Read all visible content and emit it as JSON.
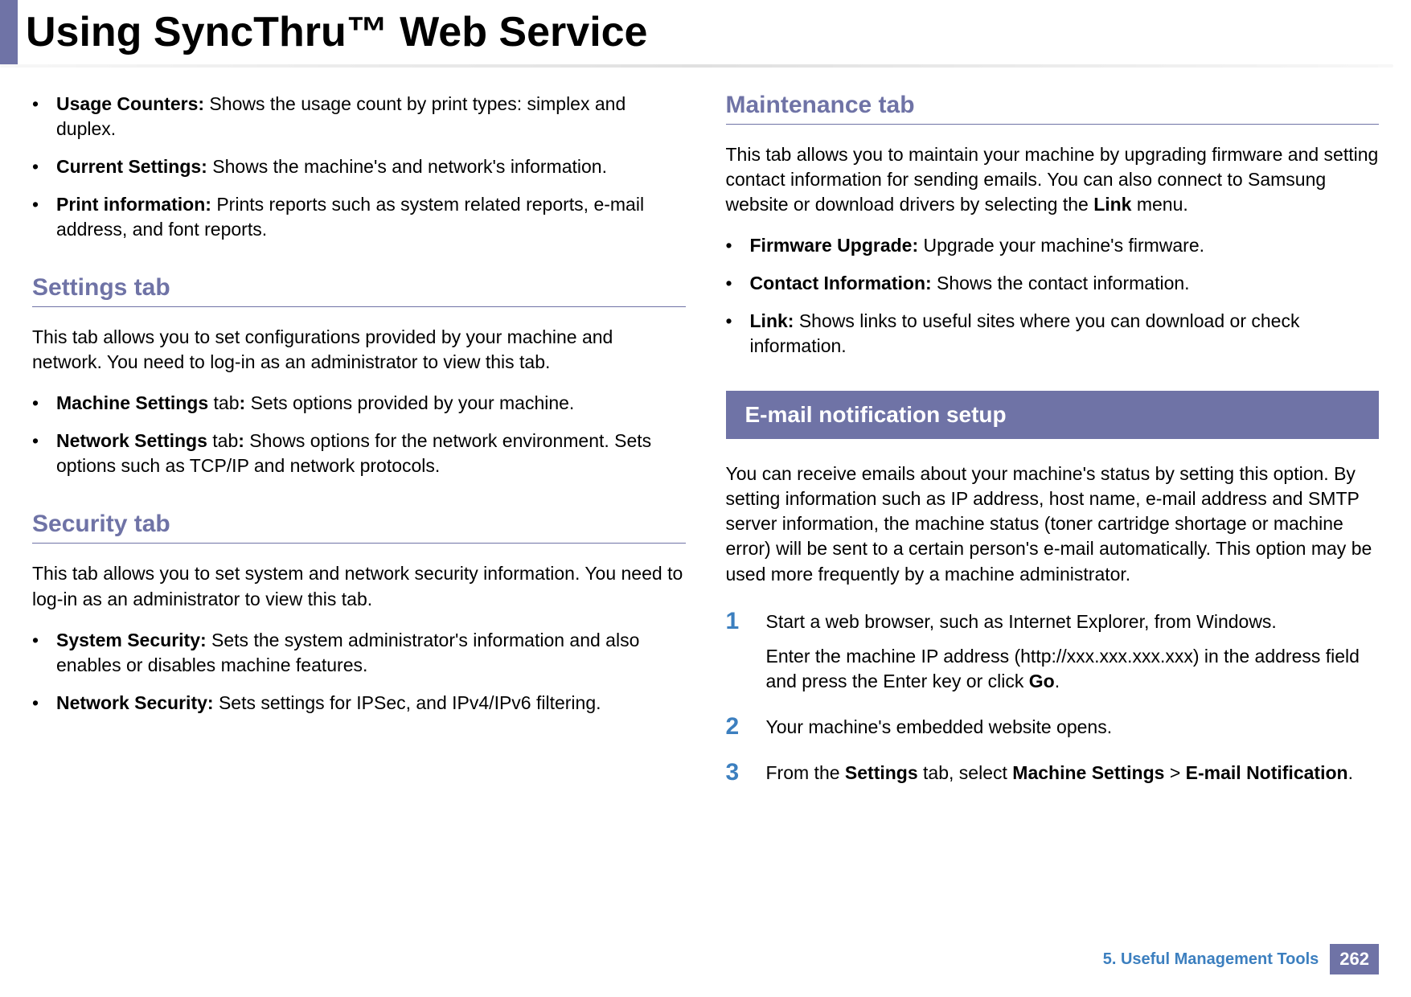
{
  "header": {
    "title": "Using SyncThru™ Web Service"
  },
  "left": {
    "bullets_top": [
      {
        "label": "Usage Counters:",
        "desc": " Shows the usage count by print types: simplex and duplex."
      },
      {
        "label": "Current Settings:",
        "desc": " Shows the machine's and network's information."
      },
      {
        "label": "Print information:",
        "desc": " Prints reports such as system related reports, e-mail address, and font reports."
      }
    ],
    "settings": {
      "title": "Settings tab",
      "intro": "This tab allows you to set configurations provided by your machine and network. You need to log-in as an administrator to view this tab.",
      "bullets": [
        {
          "label": "Machine Settings",
          "mid": " tab",
          "colon": ":",
          "desc": " Sets options provided by your machine."
        },
        {
          "label": "Network Settings",
          "mid": " tab",
          "colon": ":",
          "desc": " Shows options for the network environment. Sets options such as TCP/IP and network protocols."
        }
      ]
    },
    "security": {
      "title": "Security tab",
      "intro": "This tab allows you to set system and network security information. You need to log-in as an administrator to view this tab.",
      "bullets": [
        {
          "label": "System Security:",
          "desc": " Sets the system administrator's information and also enables or disables machine features."
        },
        {
          "label": "Network Security:",
          "desc": " Sets settings for IPSec, and IPv4/IPv6 filtering."
        }
      ]
    }
  },
  "right": {
    "maintenance": {
      "title": "Maintenance tab",
      "intro_pre": "This tab allows you to maintain your machine by upgrading firmware and setting contact information for sending emails. You can also connect to Samsung website or download drivers by selecting the ",
      "intro_bold": "Link",
      "intro_post": " menu.",
      "bullets": [
        {
          "label": "Firmware Upgrade:",
          "desc": " Upgrade your machine's firmware."
        },
        {
          "label": "Contact Information:",
          "desc": " Shows the contact information."
        },
        {
          "label": "Link:",
          "desc": " Shows links to useful sites where you can download or check information."
        }
      ]
    },
    "email_setup": {
      "block": "E-mail notification setup",
      "intro": "You can receive emails about your machine's status by setting this option. By setting information such as IP address, host name, e-mail address and SMTP server information, the machine status (toner cartridge shortage or machine error) will be sent to a certain person's e-mail automatically. This option may be used more frequently by a machine administrator.",
      "steps": {
        "s1": {
          "num": "1",
          "p1": "Start a web browser, such as Internet Explorer, from Windows.",
          "p2_pre": "Enter the machine IP address (http://xxx.xxx.xxx.xxx) in the address field and press the Enter key or click ",
          "p2_bold": "Go",
          "p2_post": "."
        },
        "s2": {
          "num": "2",
          "text": "Your machine's embedded website opens."
        },
        "s3": {
          "num": "3",
          "pre": "From the ",
          "b1": "Settings",
          "mid1": " tab, select ",
          "b2": "Machine Settings",
          "mid2": " > ",
          "b3": "E-mail Notification",
          "post": "."
        }
      }
    }
  },
  "footer": {
    "label": "5.  Useful Management Tools",
    "page": "262"
  }
}
